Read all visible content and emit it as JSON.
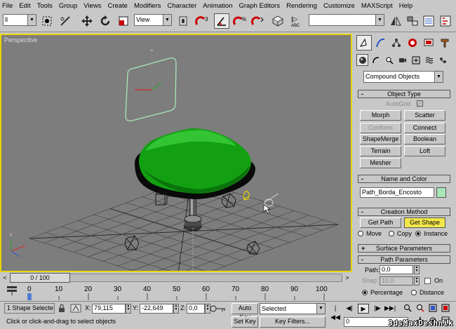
{
  "menu": [
    "File",
    "Edit",
    "Tools",
    "Group",
    "Views",
    "Create",
    "Modifiers",
    "Character",
    "Animation",
    "Graph Editors",
    "Rendering",
    "Customize",
    "MAXScript",
    "Help"
  ],
  "toolbar": {
    "selection_filter": "ll",
    "coord_system": "View",
    "named_selection": ""
  },
  "viewport": {
    "label": "Perspective",
    "bg_color": "#7d7d7d",
    "active_border_color": "#e8d500",
    "seat_color": "#12a012"
  },
  "panel": {
    "category": "Compound Objects",
    "object_type": {
      "title": "Object Type",
      "autogrid": "AutoGrid",
      "buttons": [
        "Morph",
        "Scatter",
        "Conform",
        "Connect",
        "ShapeMerge",
        "Boolean",
        "Terrain",
        "Loft",
        "Mesher"
      ]
    },
    "name_color": {
      "title": "Name and Color",
      "object_name": "Path_Borda_Encosto",
      "swatch_color": "#a8e6b8"
    },
    "creation_method": {
      "title": "Creation Method",
      "get_path": "Get Path",
      "get_shape": "Get Shape",
      "move": "Move",
      "copy": "Copy",
      "instance": "Instance"
    },
    "surface_params": {
      "title": "Surface Parameters"
    },
    "path_params": {
      "title": "Path Parameters",
      "path_label": "Path:",
      "path_value": "0,0",
      "snap_label": "Snap:",
      "snap_value": "10,0",
      "on_label": "On",
      "percentage": "Percentage",
      "distance": "Distance"
    }
  },
  "timeline": {
    "frame_display": "0 / 100",
    "ticks": [
      "0",
      "10",
      "20",
      "30",
      "40",
      "50",
      "60",
      "70",
      "80",
      "90",
      "100"
    ]
  },
  "status": {
    "selection": "1 Shape Selecte",
    "prompt": "Click or click-and-drag to select objects",
    "x_label": "X:",
    "x_value": "79,115",
    "y_label": "Y:",
    "y_value": "-22,649",
    "z_label": "Z:",
    "z_value": "0,0",
    "auto_key": "Auto Key",
    "key_mode": "Selected",
    "set_key": "Set Key",
    "key_filters": "Key Filters...",
    "current_frame": "0"
  },
  "watermark": "3dsMaxDeshnik"
}
